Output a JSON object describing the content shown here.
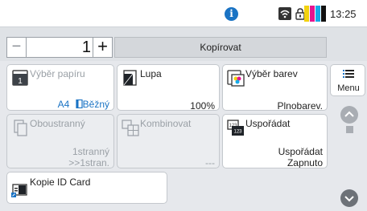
{
  "status": {
    "info_icon": "info-icon",
    "wifi_icon": "wifi-icon",
    "lock_icon": "lock-icon",
    "toner_colors": [
      "#f2d20f",
      "#e6158f",
      "#16a9e8",
      "#111111"
    ],
    "time": "13:25"
  },
  "copybar": {
    "minus_label": "−",
    "quantity": "1",
    "plus_label": "+",
    "copy_label": "Kopírovat"
  },
  "tiles": {
    "paper": {
      "title": "Výběr papíru",
      "size": "A4",
      "type": "Běžný"
    },
    "zoom": {
      "title": "Lupa",
      "value": "100%"
    },
    "color": {
      "title": "Výběr barev",
      "value": "Plnobarev."
    },
    "duplex": {
      "title": "Oboustranný",
      "value_line1": "1stranný",
      "value_line2": ">>1stran."
    },
    "combine": {
      "title": "Kombinovat",
      "value": "---"
    },
    "collate": {
      "title": "Uspořádat",
      "value_line1": "Uspořádat",
      "value_line2": "Zapnuto"
    },
    "idcard": {
      "title": "Kopie ID Card"
    }
  },
  "menu": {
    "label": "Menu"
  },
  "accent": "#1a73c4"
}
